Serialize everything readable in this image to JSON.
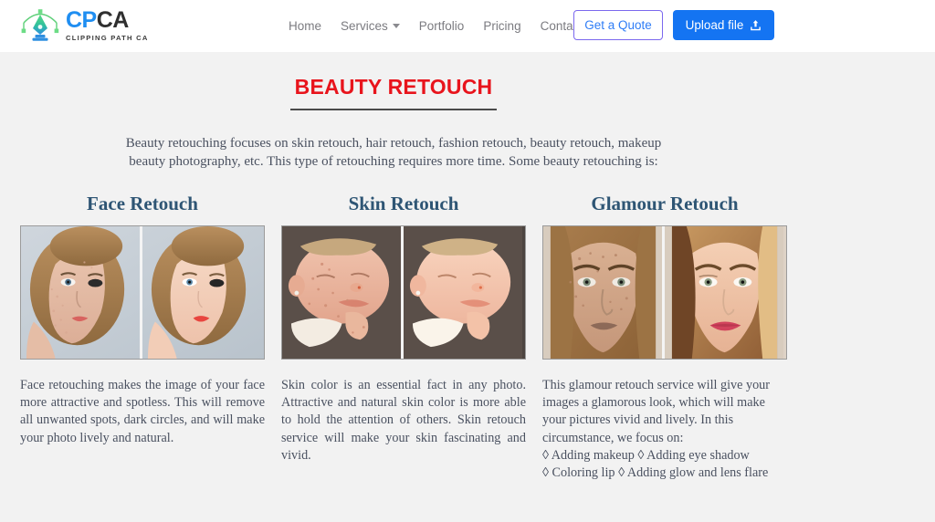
{
  "header": {
    "logo": {
      "icon": "pen-nib-icon",
      "brand_cp": "CP",
      "brand_ca": "CA",
      "tagline": "CLIPPING PATH CA"
    },
    "nav": [
      {
        "label": "Home",
        "has_caret": false
      },
      {
        "label": "Services",
        "has_caret": true
      },
      {
        "label": "Portfolio",
        "has_caret": false
      },
      {
        "label": "Pricing",
        "has_caret": false
      },
      {
        "label": "Contact Us",
        "has_caret": false
      }
    ],
    "quote_button": "Get a Quote",
    "upload_button": "Upload file",
    "upload_icon": "upload-icon",
    "colors": {
      "accent_blue": "#1474f2",
      "outline_purple": "#7b68ee",
      "nav_text": "#7b7b80",
      "logo_cp": "#1f8ef1",
      "logo_ca": "#2f2f2f"
    }
  },
  "main": {
    "title": "BEAUTY RETOUCH",
    "title_color": "#e8141c",
    "intro": "Beauty retouching focuses on skin retouch, hair retouch, fashion retouch, beauty retouch, makeup beauty photography, etc. This type of retouching requires more time. Some beauty retouching is:",
    "columns": [
      {
        "title": "Face Retouch",
        "image_alt": "face-retouch-before-after",
        "body": "Face retouching makes the image of your face more attractive and spotless. This will remove all unwanted spots, dark circles, and will make your photo lively and natural.",
        "bullets": []
      },
      {
        "title": "Skin Retouch",
        "image_alt": "skin-retouch-before-after",
        "body": "Skin color is an essential fact in any photo. Attractive and natural skin color is more able to hold the attention of others. Skin retouch service will make your skin fascinating and vivid.",
        "bullets": []
      },
      {
        "title": "Glamour Retouch",
        "image_alt": "glamour-retouch-before-after",
        "body": "This glamour retouch service will give your images a glamorous look, which will make your pictures vivid and lively. In this circumstance, we focus on:",
        "bullets": [
          "◊ Adding makeup ◊ Adding eye shadow",
          "◊ Coloring lip ◊ Adding glow and lens flare"
        ]
      }
    ],
    "heading_color": "#2e5574",
    "body_text_color": "#4a5160",
    "background": "#f2f2f2"
  }
}
